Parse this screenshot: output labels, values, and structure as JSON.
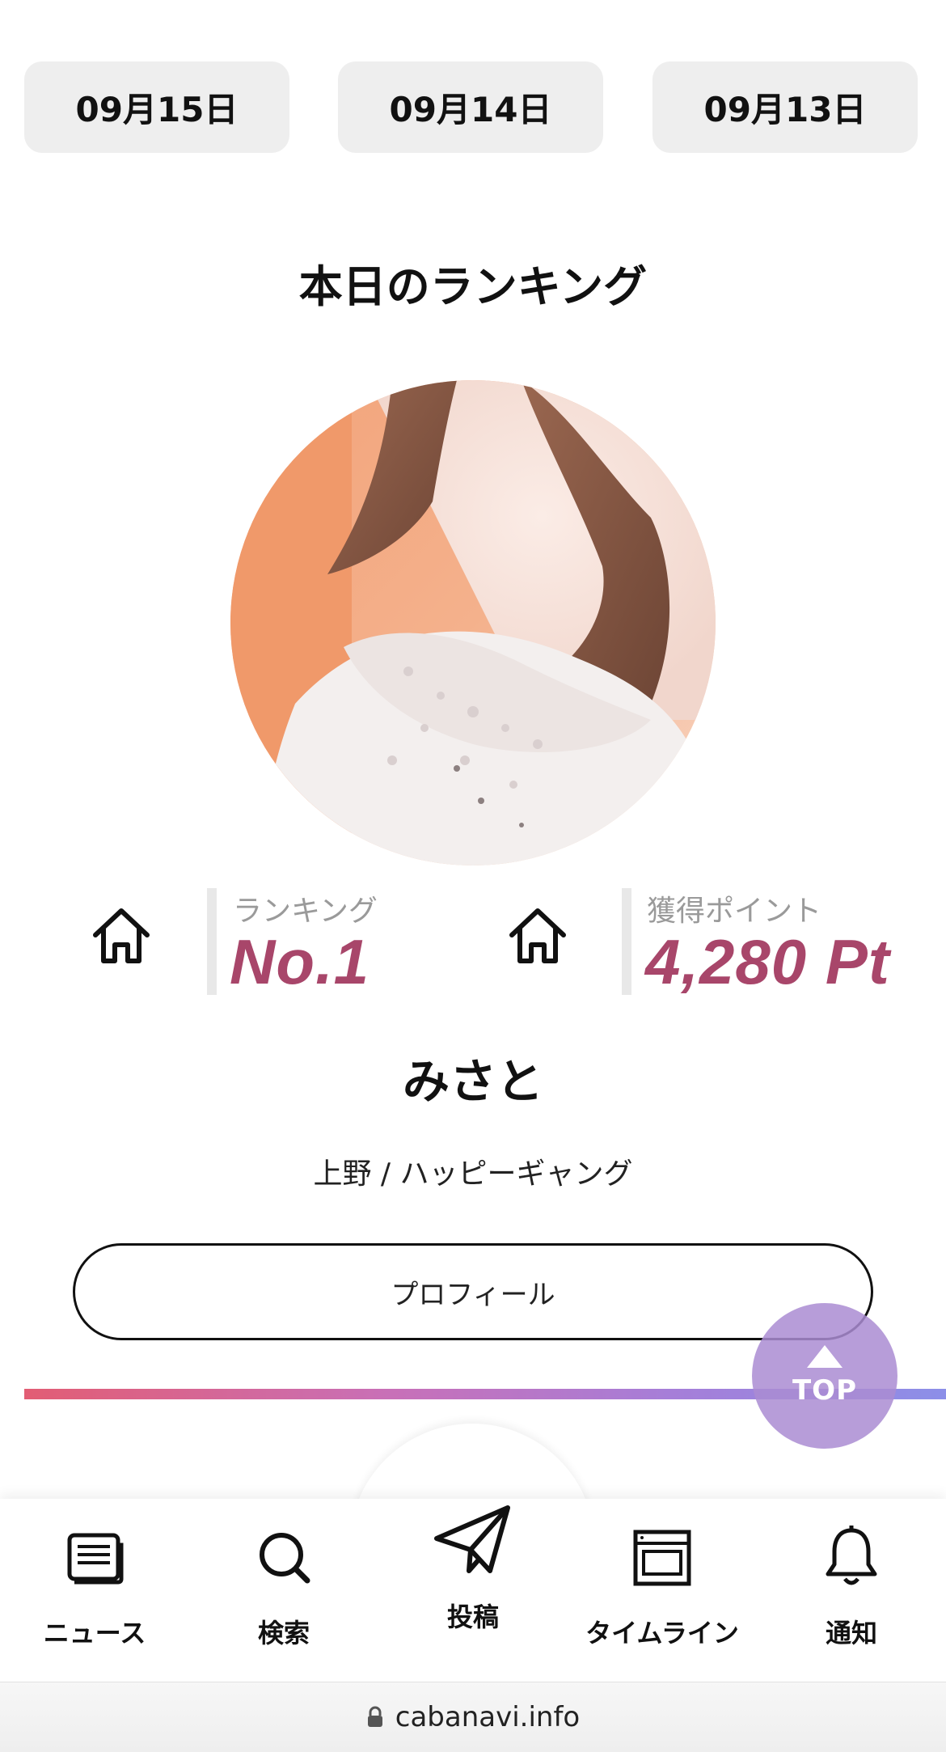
{
  "date_tabs": [
    "09月15日",
    "09月14日",
    "09月13日"
  ],
  "section_title": "本日のランキング",
  "ranking": {
    "rank_label": "ランキング",
    "rank_value": "No.1",
    "points_label": "獲得ポイント",
    "points_value": "4,280 Pt"
  },
  "cast_name": "みさと",
  "shop_line": "上野 / ハッピーギャング",
  "profile_button": "プロフィール",
  "top_button": "TOP",
  "colors": {
    "accent": "#a8466a",
    "top_button": "#aa8cd2",
    "gradient": [
      "#e25d74",
      "#c870b8",
      "#a67ed8",
      "#8c8fe8"
    ]
  },
  "bottom_nav": [
    {
      "label": "ニュース",
      "icon": "newspaper-icon"
    },
    {
      "label": "検索",
      "icon": "search-icon"
    },
    {
      "label": "投稿",
      "icon": "paper-plane-icon"
    },
    {
      "label": "タイムライン",
      "icon": "browser-window-icon"
    },
    {
      "label": "通知",
      "icon": "bell-icon"
    }
  ],
  "url": "cabanavi.info"
}
